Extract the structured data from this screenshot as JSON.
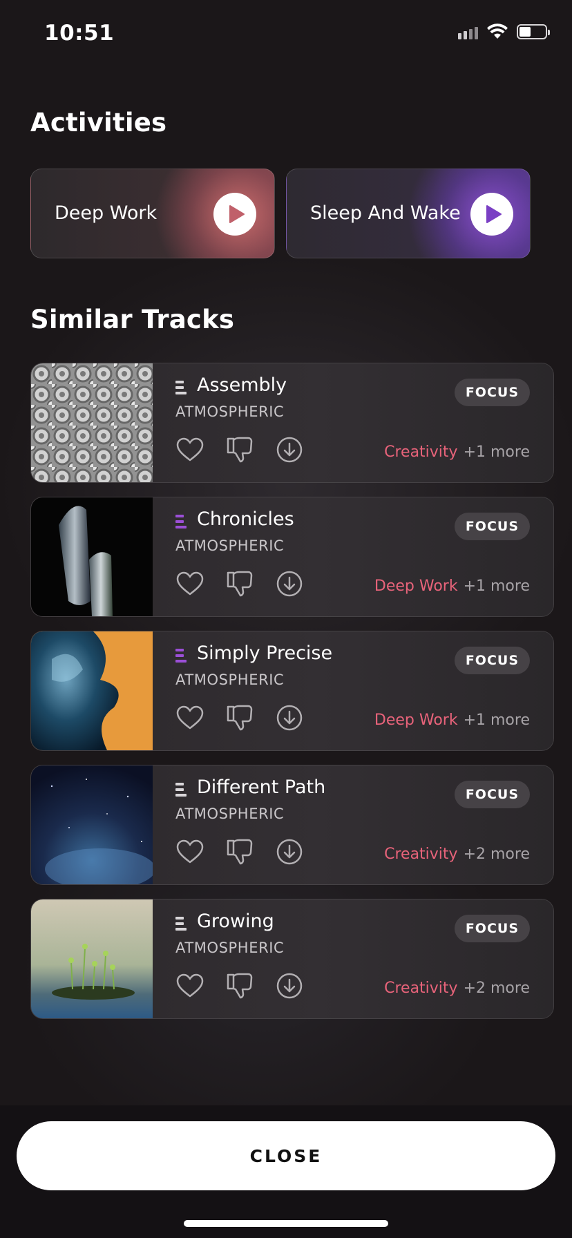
{
  "status_bar": {
    "time": "10:51"
  },
  "activities": {
    "title": "Activities",
    "items": [
      {
        "label": "Deep Work"
      },
      {
        "label": "Sleep And Wake"
      }
    ]
  },
  "similar_tracks": {
    "title": "Similar Tracks",
    "items": [
      {
        "title": "Assembly",
        "genre": "ATMOSPHERIC",
        "badge": "FOCUS",
        "tag": "Creativity",
        "more": "+1 more",
        "icon_color": "#d9d6d9"
      },
      {
        "title": "Chronicles",
        "genre": "ATMOSPHERIC",
        "badge": "FOCUS",
        "tag": "Deep Work",
        "more": "+1 more",
        "icon_color": "#9b4fd6"
      },
      {
        "title": "Simply Precise",
        "genre": "ATMOSPHERIC",
        "badge": "FOCUS",
        "tag": "Deep Work",
        "more": "+1 more",
        "icon_color": "#9b4fd6"
      },
      {
        "title": "Different Path",
        "genre": "ATMOSPHERIC",
        "badge": "FOCUS",
        "tag": "Creativity",
        "more": "+2 more",
        "icon_color": "#d9d6d9"
      },
      {
        "title": "Growing",
        "genre": "ATMOSPHERIC",
        "badge": "FOCUS",
        "tag": "Creativity",
        "more": "+2 more",
        "icon_color": "#d9d6d9"
      }
    ]
  },
  "close_button": {
    "label": "CLOSE"
  },
  "colors": {
    "background": "#1b1719",
    "accent_pink": "#e8637a",
    "deep_work_glow": "#d06e6e",
    "sleep_glow": "#8c50d2"
  },
  "icons": [
    "signal-icon",
    "wifi-icon",
    "battery-icon",
    "play-icon",
    "heart-icon",
    "thumbs-down-icon",
    "download-icon",
    "track-bars-icon"
  ]
}
